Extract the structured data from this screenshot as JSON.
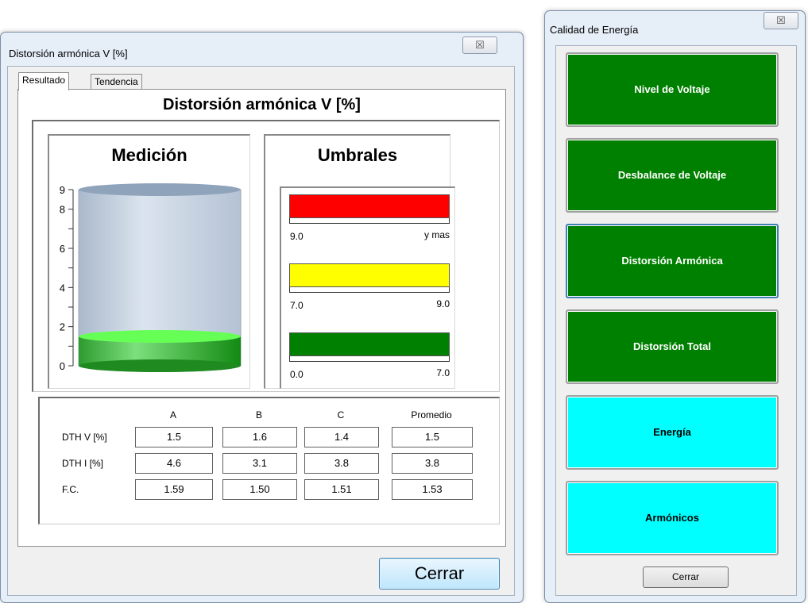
{
  "harmonic_window": {
    "title": "Distorsión armónica V [%]",
    "close_glyph": "☒",
    "tabs": [
      {
        "label": "Resultado",
        "active": true
      },
      {
        "label": "Tendencia",
        "active": false
      }
    ],
    "heading": "Distorsión armónica V [%]",
    "measurement": {
      "title": "Medición",
      "axis_ticks": [
        "9",
        "8",
        "6",
        "4",
        "2",
        "0"
      ],
      "level_value": 1.5,
      "axis_max": 9
    },
    "thresholds": {
      "title": "Umbrales",
      "bands": [
        {
          "color": "#ff0000",
          "min_label": "9.0",
          "max_label": "y mas"
        },
        {
          "color": "#ffff00",
          "min_label": "7.0",
          "max_label": "9.0"
        },
        {
          "color": "#008000",
          "min_label": "0.0",
          "max_label": "7.0"
        }
      ]
    },
    "table": {
      "columns": [
        "A",
        "B",
        "C",
        "Promedio"
      ],
      "rows": [
        {
          "label": "DTH V [%]",
          "values": [
            "1.5",
            "1.6",
            "1.4",
            "1.5"
          ]
        },
        {
          "label": "DTH I [%]",
          "values": [
            "4.6",
            "3.1",
            "3.8",
            "3.8"
          ]
        },
        {
          "label": "F.C.",
          "values": [
            "1.59",
            "1.50",
            "1.51",
            "1.53"
          ]
        }
      ]
    },
    "close_button": "Cerrar"
  },
  "quality_window": {
    "title": "Calidad de Energía",
    "close_glyph": "☒",
    "buttons": [
      {
        "label": "Nivel de Voltaje",
        "color": "#008000"
      },
      {
        "label": "Desbalance de Voltaje",
        "color": "#008000"
      },
      {
        "label": "Distorsión Armónica",
        "color": "#008000"
      },
      {
        "label": "Distorsión Total",
        "color": "#008000"
      },
      {
        "label": "Energía",
        "color": "#00ffff"
      },
      {
        "label": "Armónicos",
        "color": "#00ffff"
      }
    ],
    "close_button": "Cerrar"
  }
}
